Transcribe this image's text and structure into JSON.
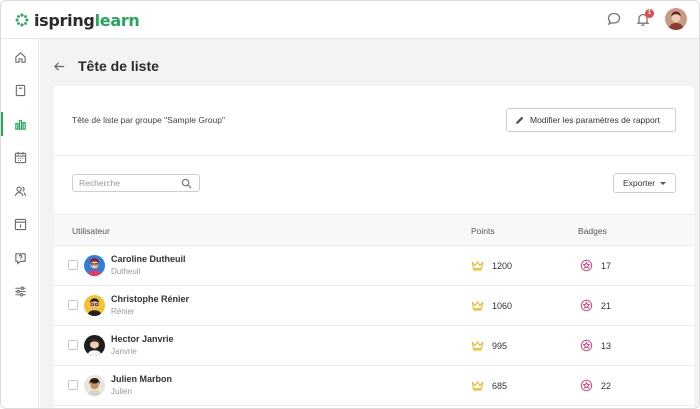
{
  "app": {
    "logo_part1": "ispring",
    "logo_part2": "learn",
    "notifications_count": "1",
    "brand_color": "#26a65b"
  },
  "page": {
    "title": "Tête de liste",
    "subtitle": "Tête de liste par groupe \"Sample Group\""
  },
  "toolbar": {
    "modify_label": "Modifier les paramètres de rapport",
    "export_label": "Exporter"
  },
  "search": {
    "placeholder": "Recherche",
    "value": ""
  },
  "table": {
    "headers": {
      "user": "Utilisateur",
      "points": "Points",
      "badges": "Badges"
    },
    "rows": [
      {
        "name": "Caroline Dutheuil",
        "login": "Dutheuil",
        "points": "1200",
        "badges": "17",
        "avatar_color": "#2f7fd8"
      },
      {
        "name": "Christophe Rénier",
        "login": "Rénier",
        "points": "1060",
        "badges": "21",
        "avatar_color": "#f2c230"
      },
      {
        "name": "Hector Janvrie",
        "login": "Janvrie",
        "points": "995",
        "badges": "13",
        "avatar_color": "#1e1e1e"
      },
      {
        "name": "Julien Marbon",
        "login": "Julien",
        "points": "685",
        "badges": "22",
        "avatar_color": "#e9e4dc"
      }
    ]
  },
  "sidebar": {
    "items": [
      {
        "icon": "home-icon"
      },
      {
        "icon": "book-icon"
      },
      {
        "icon": "reports-icon",
        "active": true
      },
      {
        "icon": "calendar-icon"
      },
      {
        "icon": "users-icon"
      },
      {
        "icon": "info-icon"
      },
      {
        "icon": "help-icon"
      },
      {
        "icon": "settings-sliders-icon"
      }
    ]
  }
}
